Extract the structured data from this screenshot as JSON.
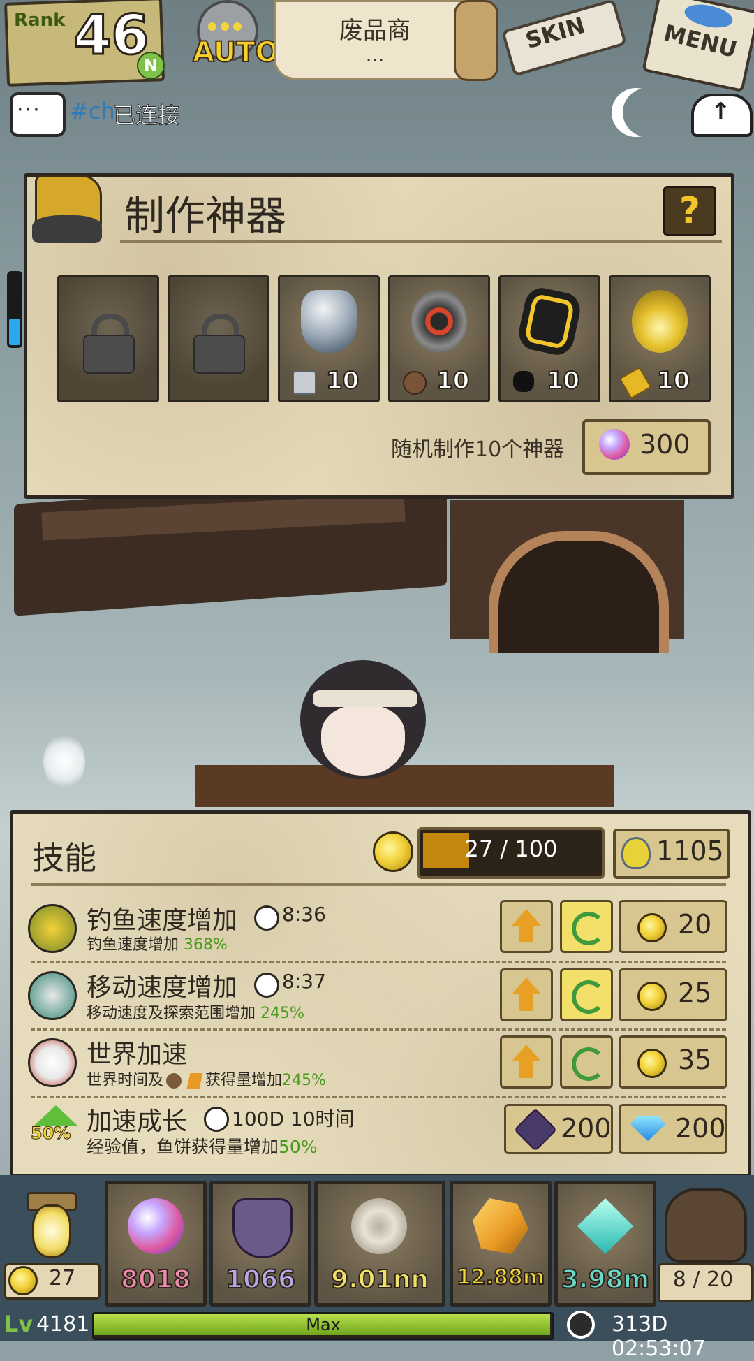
{
  "top_bar": {
    "rank_label": "Rank",
    "rank_value": "46",
    "rank_badge": "N",
    "auto_label": "AUTO",
    "location_title": "废品商",
    "location_sub": "...",
    "skin_label": "SKIN",
    "menu_label": "MENU"
  },
  "chat": {
    "channel": "#ch",
    "status": "已连接"
  },
  "craft_panel": {
    "title": "制作神器",
    "help_label": "?",
    "slots": [
      {
        "locked": true,
        "icon": "lock-icon"
      },
      {
        "locked": true,
        "icon": "lock-icon"
      },
      {
        "locked": false,
        "icon": "relic-vase-icon",
        "cost_icon": "iron-cube-icon",
        "cost": "10"
      },
      {
        "locked": false,
        "icon": "relic-target-icon",
        "cost_icon": "scrap-gear-icon",
        "cost": "10"
      },
      {
        "locked": false,
        "icon": "relic-black-stone-icon",
        "cost_icon": "coal-icon",
        "cost": "10"
      },
      {
        "locked": false,
        "icon": "relic-golden-compass-icon",
        "cost_icon": "gold-bar-icon",
        "cost": "10"
      }
    ],
    "random_label": "随机制作10个神器",
    "random_cost": "300"
  },
  "skills": {
    "title": "技能",
    "xp_text": "27 / 100",
    "xp_fraction": 0.27,
    "potion_value": "1105",
    "rows": [
      {
        "name": "钓鱼速度增加",
        "time": "8:36",
        "desc": "钓鱼速度增加 ",
        "pct": "368%",
        "cost": "20",
        "active": true
      },
      {
        "name": "移动速度增加",
        "time": "8:37",
        "desc": "移动速度及探索范围增加 ",
        "pct": "245%",
        "cost": "25",
        "active": true
      },
      {
        "name": "世界加速",
        "time": "",
        "desc": "世界时间及",
        "desc2": "获得量增加",
        "pct": "245%",
        "cost": "35",
        "active": false
      }
    ],
    "growth": {
      "badge": "50%",
      "name": "加速成长",
      "time": "100D 10时间",
      "desc": "经验值，鱼饼获得量增加",
      "pct": "50%",
      "cost_a": "200",
      "cost_b": "200"
    }
  },
  "resources": {
    "coins": "27",
    "cards": [
      {
        "icon": "rainbow-orb-icon",
        "value": "8018",
        "color": "#f28ab0"
      },
      {
        "icon": "shield-crest-icon",
        "value": "1066",
        "color": "#b8a8e8"
      },
      {
        "icon": "spiral-shell-icon",
        "value": "9.01nn",
        "color": "#f2e06a"
      },
      {
        "icon": "amber-chunk-icon",
        "value": "12.88m",
        "color": "#f2d23a"
      },
      {
        "icon": "diamond-crystal-icon",
        "value": "3.98m",
        "color": "#6ad8c8"
      }
    ],
    "bag": "8 / 20"
  },
  "status": {
    "level": "4181",
    "exp_label": "Max",
    "time": "313D 02:53:07"
  }
}
